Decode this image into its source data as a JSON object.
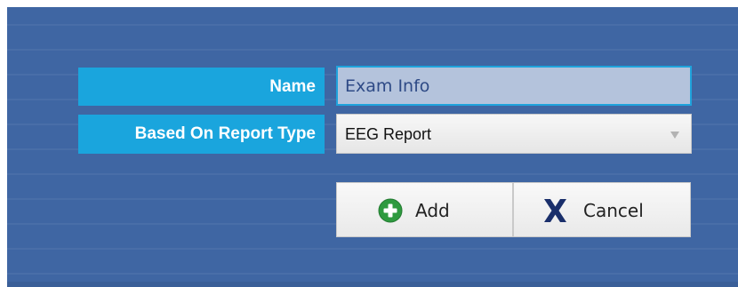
{
  "form": {
    "name_label": "Name",
    "name_value": "Exam Info",
    "report_type_label": "Based On Report Type",
    "report_type_value": "EEG Report"
  },
  "buttons": {
    "add_label": "Add",
    "add_icon": "plus-circle-icon",
    "cancel_label": "Cancel",
    "cancel_icon": "x-icon"
  },
  "colors": {
    "background": "#3f66a3",
    "label_background": "#1aa5dd",
    "input_border": "#1fa3dc",
    "add_icon_green": "#2e9a3f",
    "cancel_icon_navy": "#1a2f6b"
  }
}
